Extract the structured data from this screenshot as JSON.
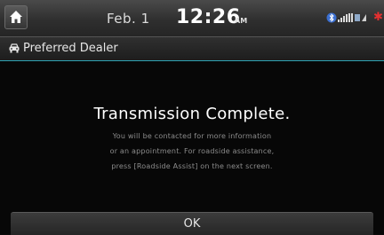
{
  "status_bar": {
    "date": "Feb.  1",
    "time": "12:26",
    "ampm": "AM",
    "icons": [
      "home-icon",
      "bluetooth-icon",
      "signal-icon",
      "alert-icon"
    ],
    "alert_glyph": "✱"
  },
  "header": {
    "title": "Preferred Dealer",
    "icon": "car-icon"
  },
  "message": {
    "title": "Transmission Complete.",
    "lines": [
      "You will be contacted for more information",
      "or an appointment. For roadside assistance,",
      "press [Roadside Assist] on the next screen."
    ]
  },
  "footer": {
    "ok_label": "OK"
  },
  "colors": {
    "accent_line": "#2fa3b3",
    "alert": "#e53030",
    "background": "#070707"
  }
}
